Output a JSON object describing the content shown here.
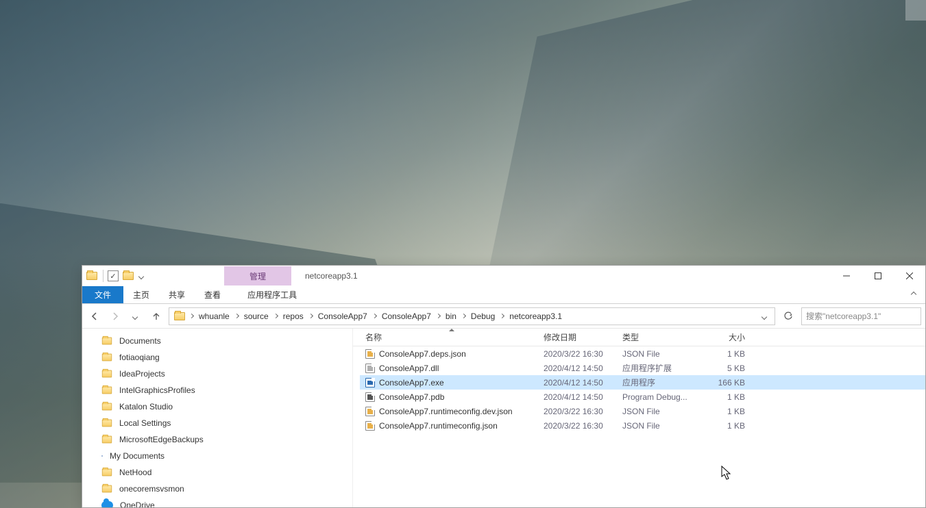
{
  "window": {
    "title": "netcoreapp3.1",
    "contextual_tab": "管理"
  },
  "ribbon": {
    "file": "文件",
    "home": "主页",
    "share": "共享",
    "view": "查看",
    "apptools": "应用程序工具"
  },
  "breadcrumb": [
    "whuanle",
    "source",
    "repos",
    "ConsoleApp7",
    "ConsoleApp7",
    "bin",
    "Debug",
    "netcoreapp3.1"
  ],
  "search_placeholder": "搜索\"netcoreapp3.1\"",
  "columns": {
    "name": "名称",
    "date": "修改日期",
    "type": "类型",
    "size": "大小"
  },
  "nav_items": [
    {
      "label": "Documents",
      "icon": "folder"
    },
    {
      "label": "fotiaoqiang",
      "icon": "folder"
    },
    {
      "label": "IdeaProjects",
      "icon": "folder"
    },
    {
      "label": "IntelGraphicsProfiles",
      "icon": "folder"
    },
    {
      "label": "Katalon Studio",
      "icon": "folder"
    },
    {
      "label": "Local Settings",
      "icon": "folder"
    },
    {
      "label": "MicrosoftEdgeBackups",
      "icon": "folder"
    },
    {
      "label": "My Documents",
      "icon": "doc"
    },
    {
      "label": "NetHood",
      "icon": "folder"
    },
    {
      "label": "onecoremsvsmon",
      "icon": "folder"
    },
    {
      "label": "OneDrive",
      "icon": "cloud"
    }
  ],
  "files": [
    {
      "name": "ConsoleApp7.deps.json",
      "date": "2020/3/22 16:30",
      "type": "JSON File",
      "size": "1 KB",
      "icon": "json",
      "selected": false
    },
    {
      "name": "ConsoleApp7.dll",
      "date": "2020/4/12 14:50",
      "type": "应用程序扩展",
      "size": "5 KB",
      "icon": "dll",
      "selected": false
    },
    {
      "name": "ConsoleApp7.exe",
      "date": "2020/4/12 14:50",
      "type": "应用程序",
      "size": "166 KB",
      "icon": "exe",
      "selected": true
    },
    {
      "name": "ConsoleApp7.pdb",
      "date": "2020/4/12 14:50",
      "type": "Program Debug...",
      "size": "1 KB",
      "icon": "pdb",
      "selected": false
    },
    {
      "name": "ConsoleApp7.runtimeconfig.dev.json",
      "date": "2020/3/22 16:30",
      "type": "JSON File",
      "size": "1 KB",
      "icon": "json",
      "selected": false
    },
    {
      "name": "ConsoleApp7.runtimeconfig.json",
      "date": "2020/3/22 16:30",
      "type": "JSON File",
      "size": "1 KB",
      "icon": "json",
      "selected": false
    }
  ]
}
